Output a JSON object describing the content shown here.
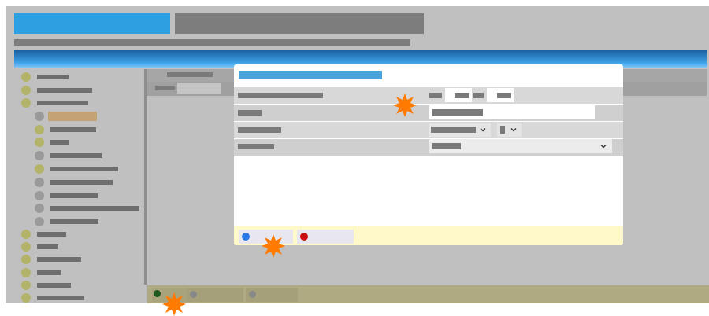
{
  "colors": {
    "accent_blue": "#2e9fe0",
    "header_dark": "#7d7d7d",
    "gradient_top": "#1b6fb5",
    "gradient_bottom": "#3ea0e6",
    "dialog_title": "#4aa3dc",
    "footer_bg": "#fff8c9",
    "taskbar_bg": "#b0aa82",
    "olive_dot": "#b4b36a",
    "gray_dot": "#9a9a9a",
    "blue_dot": "#2a77e8",
    "red_dot": "#c80e0e",
    "green_dot": "#2e6b2e",
    "burst": "#ff7a00"
  },
  "sidebar": {
    "items": [
      {
        "icon": "olive-dot-icon"
      },
      {
        "icon": "olive-dot-icon"
      },
      {
        "icon": "olive-dot-icon"
      },
      {
        "icon": "gray-dot-icon",
        "selected": true
      },
      {
        "icon": "olive-dot-icon"
      },
      {
        "icon": "olive-dot-icon"
      },
      {
        "icon": "gray-dot-icon"
      },
      {
        "icon": "olive-dot-icon"
      },
      {
        "icon": "gray-dot-icon"
      },
      {
        "icon": "gray-dot-icon"
      },
      {
        "icon": "gray-dot-icon"
      },
      {
        "icon": "gray-dot-icon"
      },
      {
        "icon": "olive-dot-icon"
      },
      {
        "icon": "olive-dot-icon"
      },
      {
        "icon": "olive-dot-icon"
      },
      {
        "icon": "olive-dot-icon"
      },
      {
        "icon": "olive-dot-icon"
      },
      {
        "icon": "olive-dot-icon"
      }
    ]
  },
  "dialog": {
    "footer": {
      "buttons": [
        {
          "icon": "blue-dot-icon"
        },
        {
          "icon": "red-dot-icon"
        }
      ]
    }
  },
  "taskbar": {
    "items": [
      {
        "icon": "green-dot-icon",
        "active": true
      },
      {
        "icon": "gray-dot-icon"
      },
      {
        "icon": "gray-dot-icon"
      }
    ]
  },
  "markers": [
    "click-marker-icon",
    "click-marker-icon",
    "click-marker-icon"
  ]
}
